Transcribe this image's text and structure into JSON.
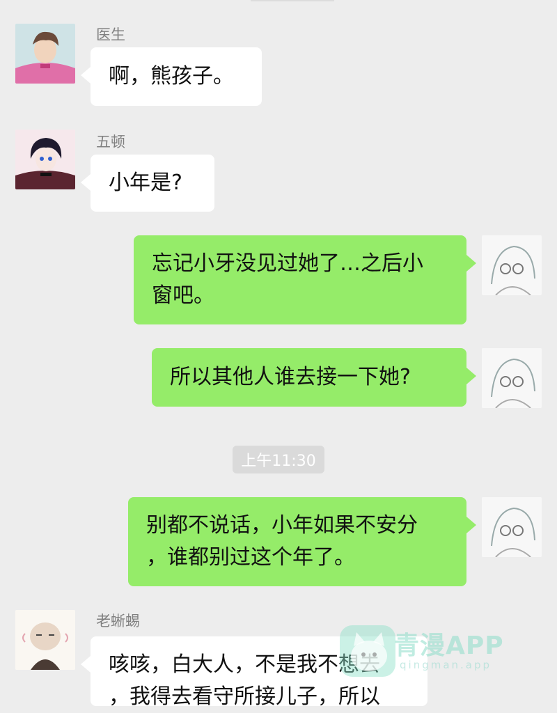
{
  "messages": [
    {
      "sender": "医生",
      "text": "啊，熊孩子。",
      "side": "left",
      "avatar_icon": "doctor-avatar"
    },
    {
      "sender": "五顿",
      "text": "小年是?",
      "side": "left",
      "avatar_icon": "wudun-avatar"
    },
    {
      "text_lines": [
        "忘记小牙没见过她了…之后小",
        "窗吧。"
      ],
      "side": "right",
      "avatar_icon": "self-avatar"
    },
    {
      "text": "所以其他人谁去接一下她?",
      "side": "right",
      "avatar_icon": "self-avatar"
    },
    {
      "text_lines": [
        "别都不说话，小年如果不安分",
        "，谁都别过这个年了。"
      ],
      "side": "right",
      "avatar_icon": "self-avatar"
    },
    {
      "sender": "老蜥蜴",
      "text_lines": [
        "咳咳，白大人，不是我不想去",
        "，我得去看守所接儿子，所以"
      ],
      "side": "left",
      "avatar_icon": "old-lizard-avatar"
    }
  ],
  "timestamp": "上午11:30",
  "watermark": {
    "title": "青漫APP",
    "subtitle": "qingman.app"
  },
  "colors": {
    "background": "#ededed",
    "bubble_self": "#95ec69",
    "bubble_other": "#ffffff"
  }
}
